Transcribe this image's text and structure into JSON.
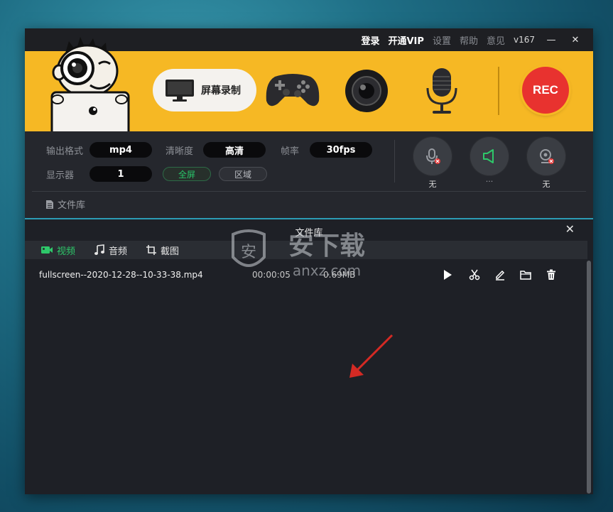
{
  "titlebar": {
    "login": "登录",
    "vip": "开通VIP",
    "settings": "设置",
    "help": "帮助",
    "feedback": "意见",
    "version": "v167",
    "minimize": "—",
    "close": "✕"
  },
  "banner": {
    "screen_mode_label": "屏幕录制",
    "rec_label": "REC"
  },
  "settings": {
    "format_label": "输出格式",
    "format_value": "mp4",
    "clarity_label": "清晰度",
    "clarity_value": "高清",
    "fps_label": "帧率",
    "fps_value": "30fps",
    "display_label": "显示器",
    "display_value": "1",
    "fullscreen_button": "全屏",
    "region_button": "区域",
    "mic_caption": "无",
    "speaker_caption": "···",
    "camera_caption": "无",
    "library_link": "文件库"
  },
  "library": {
    "title": "文件库",
    "close": "✕",
    "tabs": [
      {
        "label": "视频"
      },
      {
        "label": "音频"
      },
      {
        "label": "截图"
      }
    ],
    "files": [
      {
        "name": "fullscreen--2020-12-28--10-33-38.mp4",
        "duration": "00:00:05",
        "size": "0.69MB"
      }
    ]
  },
  "watermark": {
    "text": "安下载",
    "sub": "anxz.com"
  },
  "colors": {
    "banner": "#f6b824",
    "rec": "#e8322f",
    "active_tab": "#2ec86a",
    "accent_line": "#2c9cb5"
  }
}
